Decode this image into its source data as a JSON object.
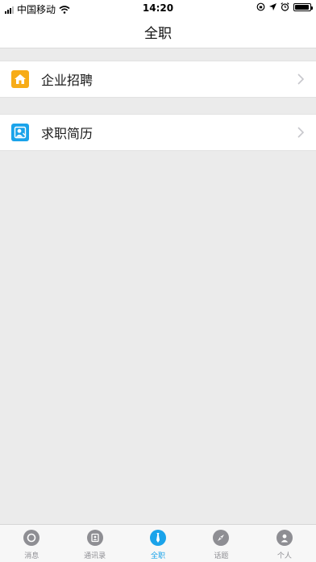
{
  "status_bar": {
    "carrier": "中国移动",
    "time": "14:20",
    "battery_level": 0.95
  },
  "nav": {
    "title": "全职"
  },
  "menu": [
    {
      "label": "企业招聘",
      "icon": "house-icon",
      "icon_color": "#f7ac18"
    },
    {
      "label": "求职简历",
      "icon": "person-card-icon",
      "icon_color": "#1aa3ea"
    }
  ],
  "tabbar": {
    "active_color": "#1aa3ea",
    "inactive_color": "#8e8e93",
    "tabs": [
      {
        "label": "消息",
        "icon": "chat-bubble-icon",
        "active": false
      },
      {
        "label": "通讯录",
        "icon": "contacts-book-icon",
        "active": false
      },
      {
        "label": "全职",
        "icon": "tie-icon",
        "active": true
      },
      {
        "label": "话题",
        "icon": "compass-icon",
        "active": false
      },
      {
        "label": "个人",
        "icon": "user-icon",
        "active": false
      }
    ]
  }
}
